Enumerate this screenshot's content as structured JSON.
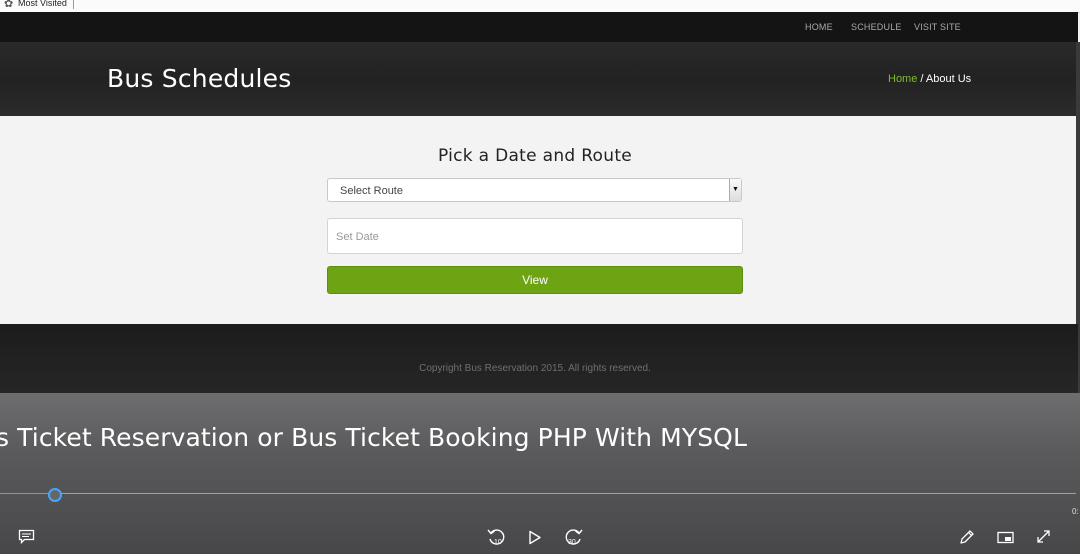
{
  "bookmarks": {
    "icon": "gear-icon",
    "label": "Most Visited"
  },
  "nav": {
    "home": "HOME",
    "schedule": "SCHEDULE",
    "visit": "VISIT SITE"
  },
  "hero": {
    "title": "Bus Schedules",
    "crumb_home": "Home",
    "crumb_sep": " / ",
    "crumb_current": "About Us"
  },
  "form": {
    "heading": "Pick a Date and Route",
    "route_value": "Select Route",
    "date_placeholder": "Set Date",
    "view_label": "View"
  },
  "footer": {
    "copyright": "Copyright Bus Reservation 2015. All rights reserved."
  },
  "player": {
    "title": "s Ticket Reservation or Bus Ticket Booking PHP With MYSQL",
    "timecode": "0:",
    "progress": 0.045,
    "controls": [
      "captions-icon",
      "rewind-10-icon",
      "play-icon",
      "forward-30-icon",
      "pen-icon",
      "miniplayer-icon",
      "fullscreen-icon"
    ],
    "rewind_label": "10",
    "forward_label": "30"
  },
  "colors": {
    "accent": "#6ea313",
    "breadcrumb_home": "#7bbf2a",
    "progress": "#4aa3ff"
  }
}
